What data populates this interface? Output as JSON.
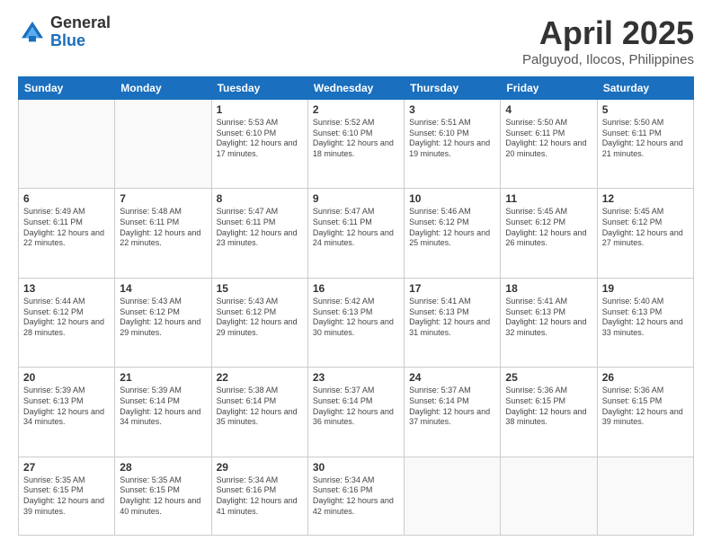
{
  "logo": {
    "general": "General",
    "blue": "Blue"
  },
  "title": {
    "month": "April 2025",
    "location": "Palguyod, Ilocos, Philippines"
  },
  "weekdays": [
    "Sunday",
    "Monday",
    "Tuesday",
    "Wednesday",
    "Thursday",
    "Friday",
    "Saturday"
  ],
  "weeks": [
    [
      {
        "day": "",
        "info": ""
      },
      {
        "day": "",
        "info": ""
      },
      {
        "day": "1",
        "info": "Sunrise: 5:53 AM\nSunset: 6:10 PM\nDaylight: 12 hours and 17 minutes."
      },
      {
        "day": "2",
        "info": "Sunrise: 5:52 AM\nSunset: 6:10 PM\nDaylight: 12 hours and 18 minutes."
      },
      {
        "day": "3",
        "info": "Sunrise: 5:51 AM\nSunset: 6:10 PM\nDaylight: 12 hours and 19 minutes."
      },
      {
        "day": "4",
        "info": "Sunrise: 5:50 AM\nSunset: 6:11 PM\nDaylight: 12 hours and 20 minutes."
      },
      {
        "day": "5",
        "info": "Sunrise: 5:50 AM\nSunset: 6:11 PM\nDaylight: 12 hours and 21 minutes."
      }
    ],
    [
      {
        "day": "6",
        "info": "Sunrise: 5:49 AM\nSunset: 6:11 PM\nDaylight: 12 hours and 22 minutes."
      },
      {
        "day": "7",
        "info": "Sunrise: 5:48 AM\nSunset: 6:11 PM\nDaylight: 12 hours and 22 minutes."
      },
      {
        "day": "8",
        "info": "Sunrise: 5:47 AM\nSunset: 6:11 PM\nDaylight: 12 hours and 23 minutes."
      },
      {
        "day": "9",
        "info": "Sunrise: 5:47 AM\nSunset: 6:11 PM\nDaylight: 12 hours and 24 minutes."
      },
      {
        "day": "10",
        "info": "Sunrise: 5:46 AM\nSunset: 6:12 PM\nDaylight: 12 hours and 25 minutes."
      },
      {
        "day": "11",
        "info": "Sunrise: 5:45 AM\nSunset: 6:12 PM\nDaylight: 12 hours and 26 minutes."
      },
      {
        "day": "12",
        "info": "Sunrise: 5:45 AM\nSunset: 6:12 PM\nDaylight: 12 hours and 27 minutes."
      }
    ],
    [
      {
        "day": "13",
        "info": "Sunrise: 5:44 AM\nSunset: 6:12 PM\nDaylight: 12 hours and 28 minutes."
      },
      {
        "day": "14",
        "info": "Sunrise: 5:43 AM\nSunset: 6:12 PM\nDaylight: 12 hours and 29 minutes."
      },
      {
        "day": "15",
        "info": "Sunrise: 5:43 AM\nSunset: 6:12 PM\nDaylight: 12 hours and 29 minutes."
      },
      {
        "day": "16",
        "info": "Sunrise: 5:42 AM\nSunset: 6:13 PM\nDaylight: 12 hours and 30 minutes."
      },
      {
        "day": "17",
        "info": "Sunrise: 5:41 AM\nSunset: 6:13 PM\nDaylight: 12 hours and 31 minutes."
      },
      {
        "day": "18",
        "info": "Sunrise: 5:41 AM\nSunset: 6:13 PM\nDaylight: 12 hours and 32 minutes."
      },
      {
        "day": "19",
        "info": "Sunrise: 5:40 AM\nSunset: 6:13 PM\nDaylight: 12 hours and 33 minutes."
      }
    ],
    [
      {
        "day": "20",
        "info": "Sunrise: 5:39 AM\nSunset: 6:13 PM\nDaylight: 12 hours and 34 minutes."
      },
      {
        "day": "21",
        "info": "Sunrise: 5:39 AM\nSunset: 6:14 PM\nDaylight: 12 hours and 34 minutes."
      },
      {
        "day": "22",
        "info": "Sunrise: 5:38 AM\nSunset: 6:14 PM\nDaylight: 12 hours and 35 minutes."
      },
      {
        "day": "23",
        "info": "Sunrise: 5:37 AM\nSunset: 6:14 PM\nDaylight: 12 hours and 36 minutes."
      },
      {
        "day": "24",
        "info": "Sunrise: 5:37 AM\nSunset: 6:14 PM\nDaylight: 12 hours and 37 minutes."
      },
      {
        "day": "25",
        "info": "Sunrise: 5:36 AM\nSunset: 6:15 PM\nDaylight: 12 hours and 38 minutes."
      },
      {
        "day": "26",
        "info": "Sunrise: 5:36 AM\nSunset: 6:15 PM\nDaylight: 12 hours and 39 minutes."
      }
    ],
    [
      {
        "day": "27",
        "info": "Sunrise: 5:35 AM\nSunset: 6:15 PM\nDaylight: 12 hours and 39 minutes."
      },
      {
        "day": "28",
        "info": "Sunrise: 5:35 AM\nSunset: 6:15 PM\nDaylight: 12 hours and 40 minutes."
      },
      {
        "day": "29",
        "info": "Sunrise: 5:34 AM\nSunset: 6:16 PM\nDaylight: 12 hours and 41 minutes."
      },
      {
        "day": "30",
        "info": "Sunrise: 5:34 AM\nSunset: 6:16 PM\nDaylight: 12 hours and 42 minutes."
      },
      {
        "day": "",
        "info": ""
      },
      {
        "day": "",
        "info": ""
      },
      {
        "day": "",
        "info": ""
      }
    ]
  ]
}
